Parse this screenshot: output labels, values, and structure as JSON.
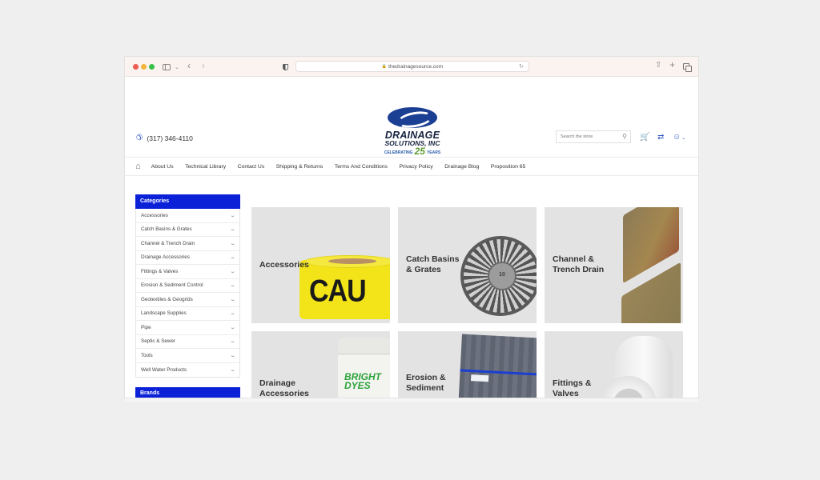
{
  "browser": {
    "url": "thedrainagesource.com"
  },
  "header": {
    "phone": "(317) 346-4110",
    "logo": {
      "line1": "DRAINAGE",
      "line2": "SOLUTIONS, INC",
      "line3_left": "CELEBRATING",
      "line3_num": "25",
      "line3_right": "YEARS"
    },
    "search_placeholder": "Search the store"
  },
  "nav": {
    "items": [
      "About Us",
      "Technical Library",
      "Contact Us",
      "Shipping & Returns",
      "Terms And Conditions",
      "Privacy Policy",
      "Drainage Blog",
      "Proposition 65"
    ]
  },
  "sidebar": {
    "categories_title": "Categories",
    "categories": [
      "Accessories",
      "Catch Basins & Grates",
      "Channel & Trench Drain",
      "Drainage Accessories",
      "Fittings & Valves",
      "Erosion & Sediment Control",
      "Geotextiles & Geogrids",
      "Landscape Supplies",
      "Pipe",
      "Septic & Sewer",
      "Tools",
      "Well Water Products"
    ],
    "brands_title": "Brands"
  },
  "tiles": [
    {
      "label_line1": "Accessories",
      "label_line2": "",
      "image_text": "CAU"
    },
    {
      "label_line1": "Catch Basins",
      "label_line2": "& Grates"
    },
    {
      "label_line1": "Channel &",
      "label_line2": "Trench Drain"
    },
    {
      "label_line1": "Drainage",
      "label_line2": "Accessories",
      "image_text_1": "BRIGHT",
      "image_text_2": "DYES"
    },
    {
      "label_line1": "Erosion &",
      "label_line2": "Sediment"
    },
    {
      "label_line1": "Fittings &",
      "label_line2": "Valves"
    }
  ],
  "colors": {
    "brand_blue": "#0a21d8",
    "icon_blue": "#2f55c8"
  }
}
